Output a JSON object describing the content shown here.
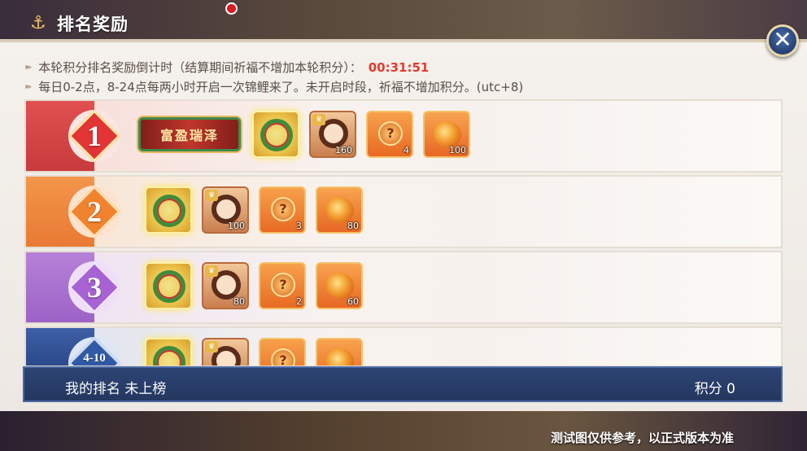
{
  "header": {
    "title": "排名奖励"
  },
  "info": {
    "line1_text": "本轮积分排名奖励倒计时（结算期间祈福不增加本轮积分）：",
    "line1_timer": "00:31:51",
    "line2_text": "每日0-2点，8-24点每两小时开启一次锦鲤来了。未开启时段，祈福不增加积分。(utc+8)"
  },
  "ranks": [
    {
      "rank": "1",
      "title_badge": "富盈瑞泽",
      "portrait_qty": "160",
      "orb_qty": "4",
      "stone_qty": "100"
    },
    {
      "rank": "2",
      "portrait_qty": "100",
      "orb_qty": "3",
      "stone_qty": "80"
    },
    {
      "rank": "3",
      "portrait_qty": "80",
      "orb_qty": "2",
      "stone_qty": "60"
    },
    {
      "rank": "4-10"
    }
  ],
  "my_rank": {
    "label": "我的排名  未上榜",
    "score": "积分 0"
  },
  "footer": {
    "note": "测试图仅供参考，以正式版本为准"
  },
  "colors": {
    "timer": "#e23b2e",
    "panel_bg": "#f5f1ec",
    "my_rank_bar": "#2d4474"
  }
}
